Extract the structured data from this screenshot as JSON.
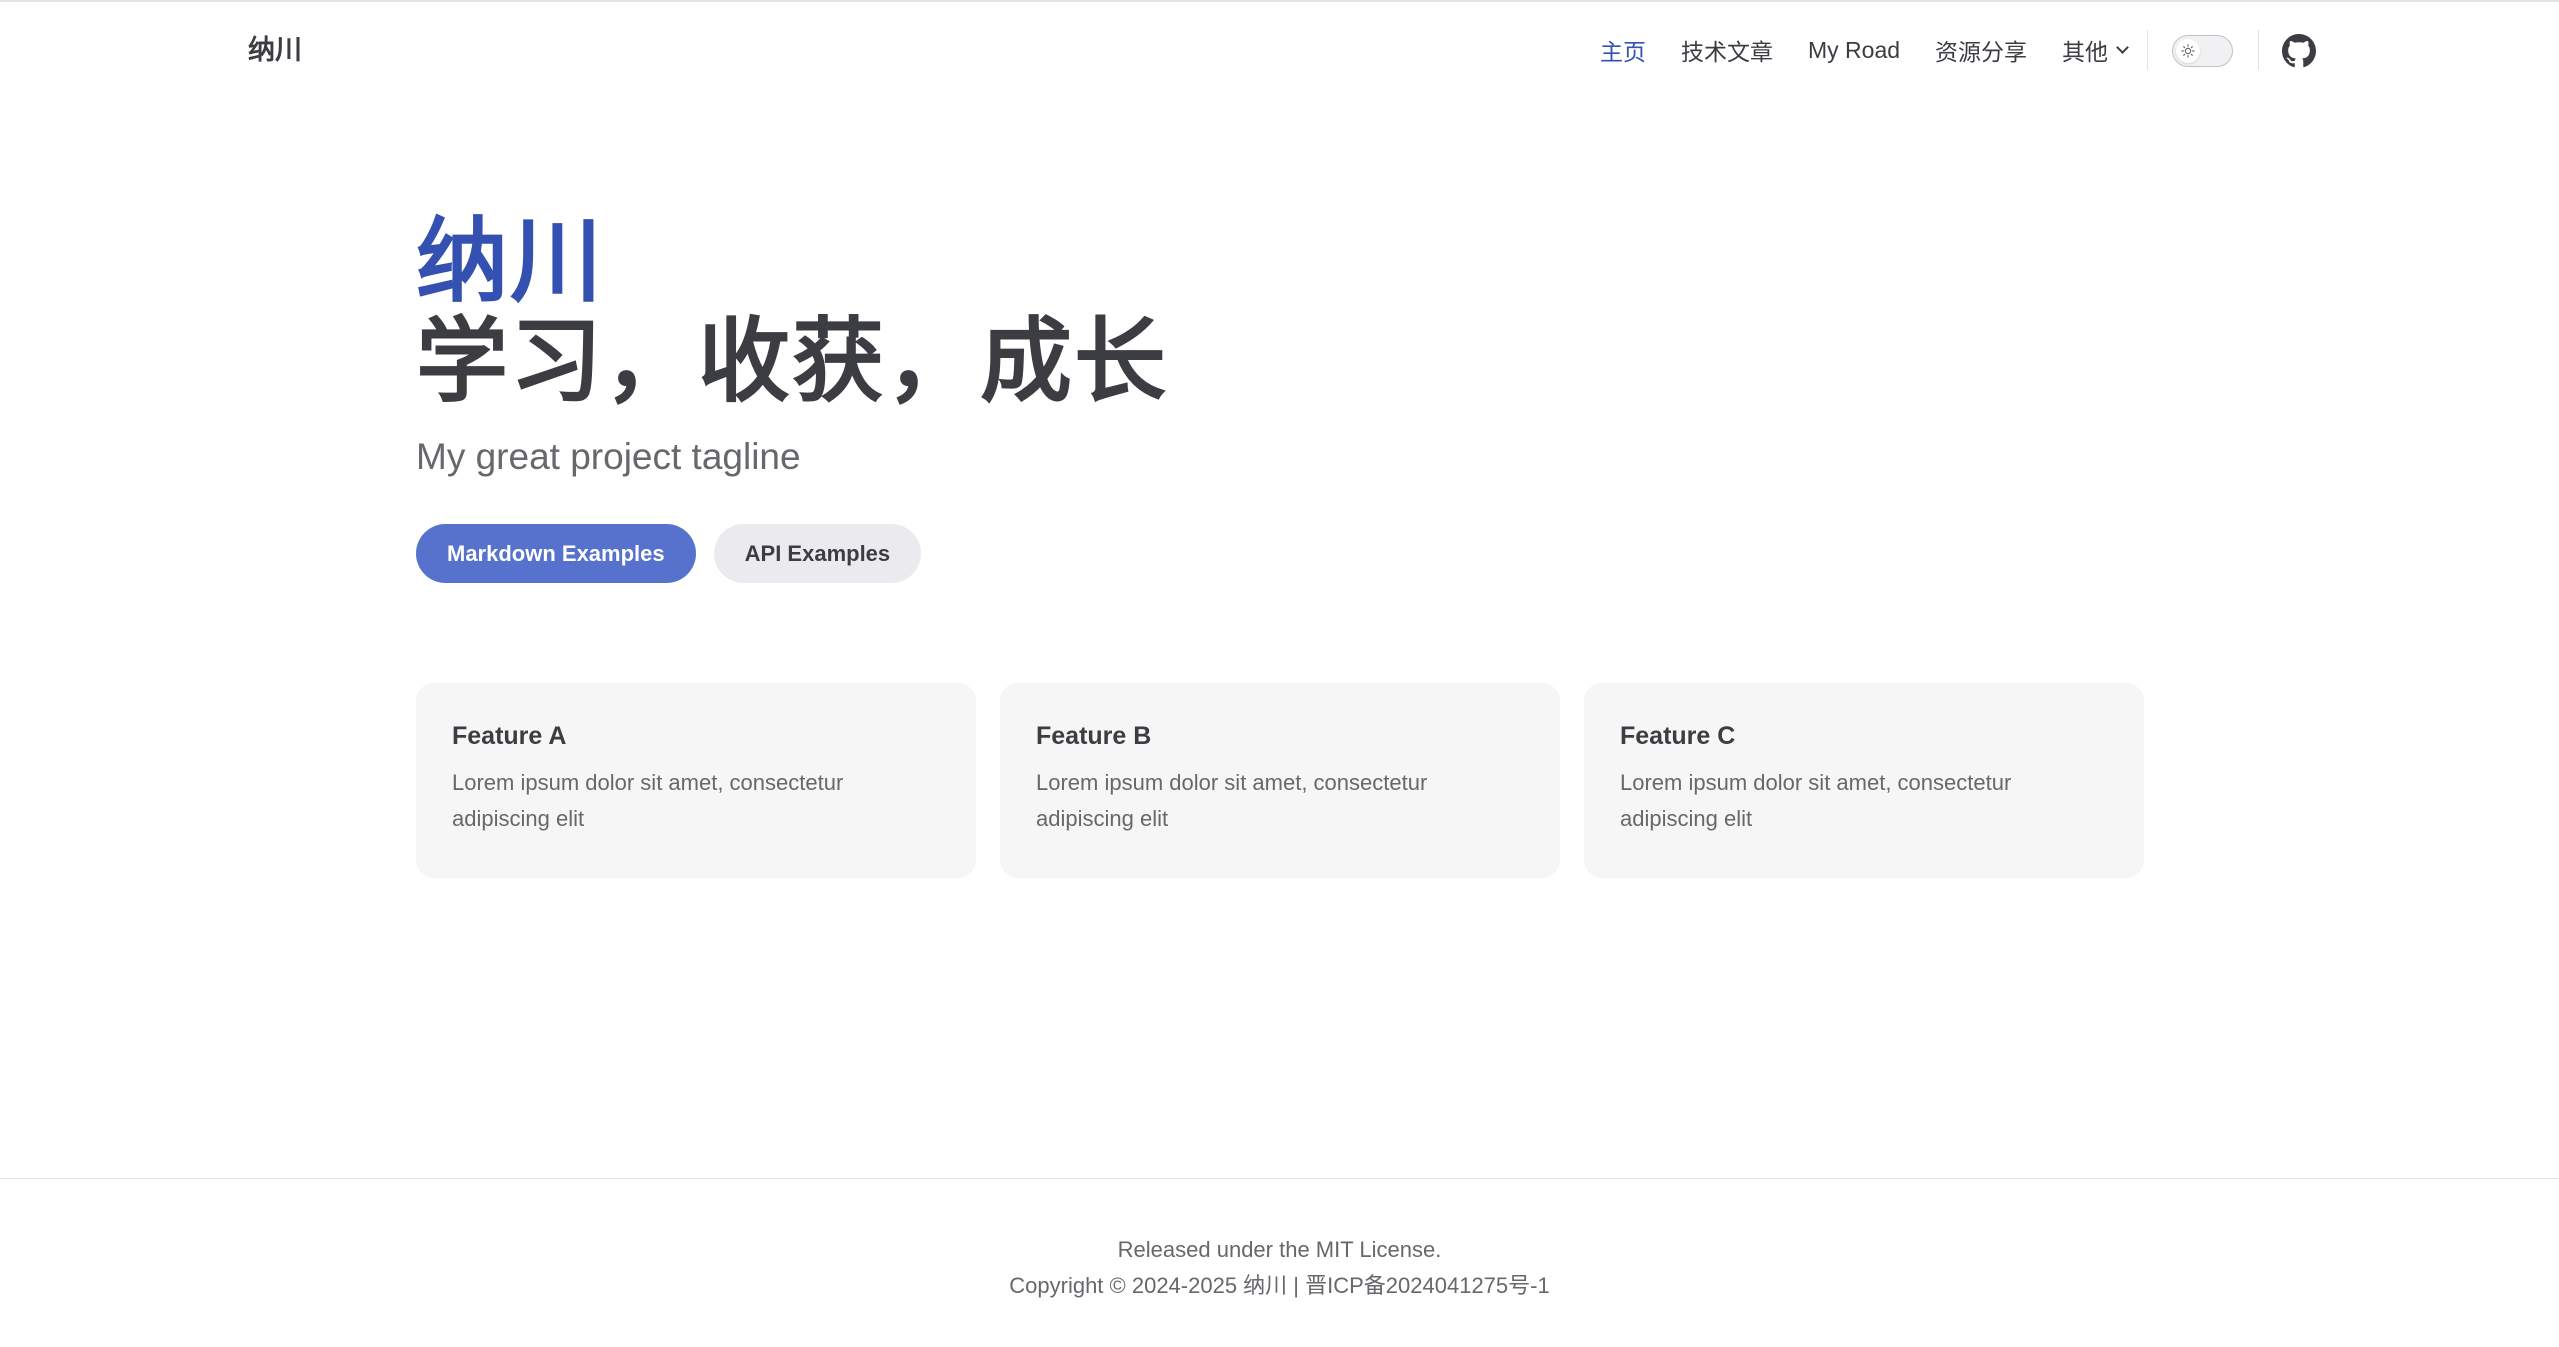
{
  "site": {
    "title": "纳川"
  },
  "nav": {
    "items": [
      {
        "label": "主页",
        "active": true
      },
      {
        "label": "技术文章"
      },
      {
        "label": "My Road"
      },
      {
        "label": "资源分享"
      },
      {
        "label": "其他",
        "dropdown": true
      }
    ]
  },
  "appearance": {
    "mode": "light",
    "icon": "sun-icon"
  },
  "social": {
    "icon": "github-icon"
  },
  "hero": {
    "name": "纳川",
    "text": "学习，收获，成长",
    "tagline": "My great project tagline",
    "actions": [
      {
        "label": "Markdown Examples",
        "theme": "brand"
      },
      {
        "label": "API Examples",
        "theme": "alt"
      }
    ]
  },
  "features": [
    {
      "title": "Feature A",
      "details": "Lorem ipsum dolor sit amet, consectetur adipiscing elit"
    },
    {
      "title": "Feature B",
      "details": "Lorem ipsum dolor sit amet, consectetur adipiscing elit"
    },
    {
      "title": "Feature C",
      "details": "Lorem ipsum dolor sit amet, consectetur adipiscing elit"
    }
  ],
  "footer": {
    "message": "Released under the MIT License.",
    "copyright": "Copyright © 2024-2025 纳川 | 晋ICP备2024041275号-1"
  },
  "colors": {
    "brand": "#3451b2",
    "brand_button": "#5672cd",
    "text": "#3c3c43",
    "muted": "#67676c",
    "card_bg": "#f6f6f7"
  }
}
